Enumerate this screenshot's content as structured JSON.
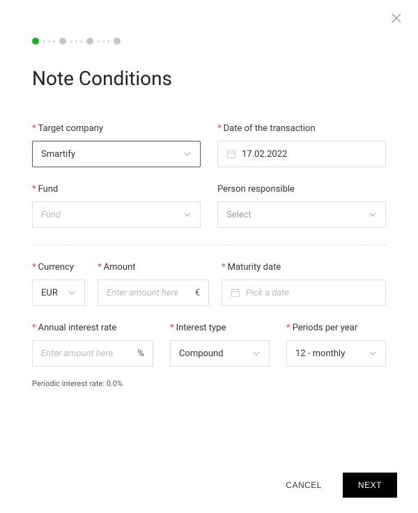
{
  "title": "Note Conditions",
  "stepper": {
    "total": 4,
    "active": 0
  },
  "fields": {
    "target_company": {
      "label": "Target company",
      "required": true,
      "value": "Smartify"
    },
    "transaction_date": {
      "label": "Date of the transaction",
      "required": true,
      "value": "17.02.2022"
    },
    "fund": {
      "label": "Fund",
      "required": true,
      "placeholder": "Fund"
    },
    "person_responsible": {
      "label": "Person responsible",
      "required": false,
      "placeholder": "Select"
    },
    "currency": {
      "label": "Currency",
      "required": true,
      "value": "EUR"
    },
    "amount": {
      "label": "Amount",
      "required": true,
      "placeholder": "Enter amount here",
      "suffix": "€"
    },
    "maturity_date": {
      "label": "Maturity date",
      "required": true,
      "placeholder": "Pick a date"
    },
    "annual_interest_rate": {
      "label": "Annual interest rate",
      "required": true,
      "placeholder": "Enter amount here",
      "suffix": "%"
    },
    "interest_type": {
      "label": "Interest type",
      "required": true,
      "value": "Compound"
    },
    "periods_per_year": {
      "label": "Periods per year",
      "required": true,
      "value": "12 - monthly"
    }
  },
  "periodic_rate_label": "Periodic interest rate: 0.0%",
  "buttons": {
    "cancel": "CANCEL",
    "next": "NEXT"
  }
}
